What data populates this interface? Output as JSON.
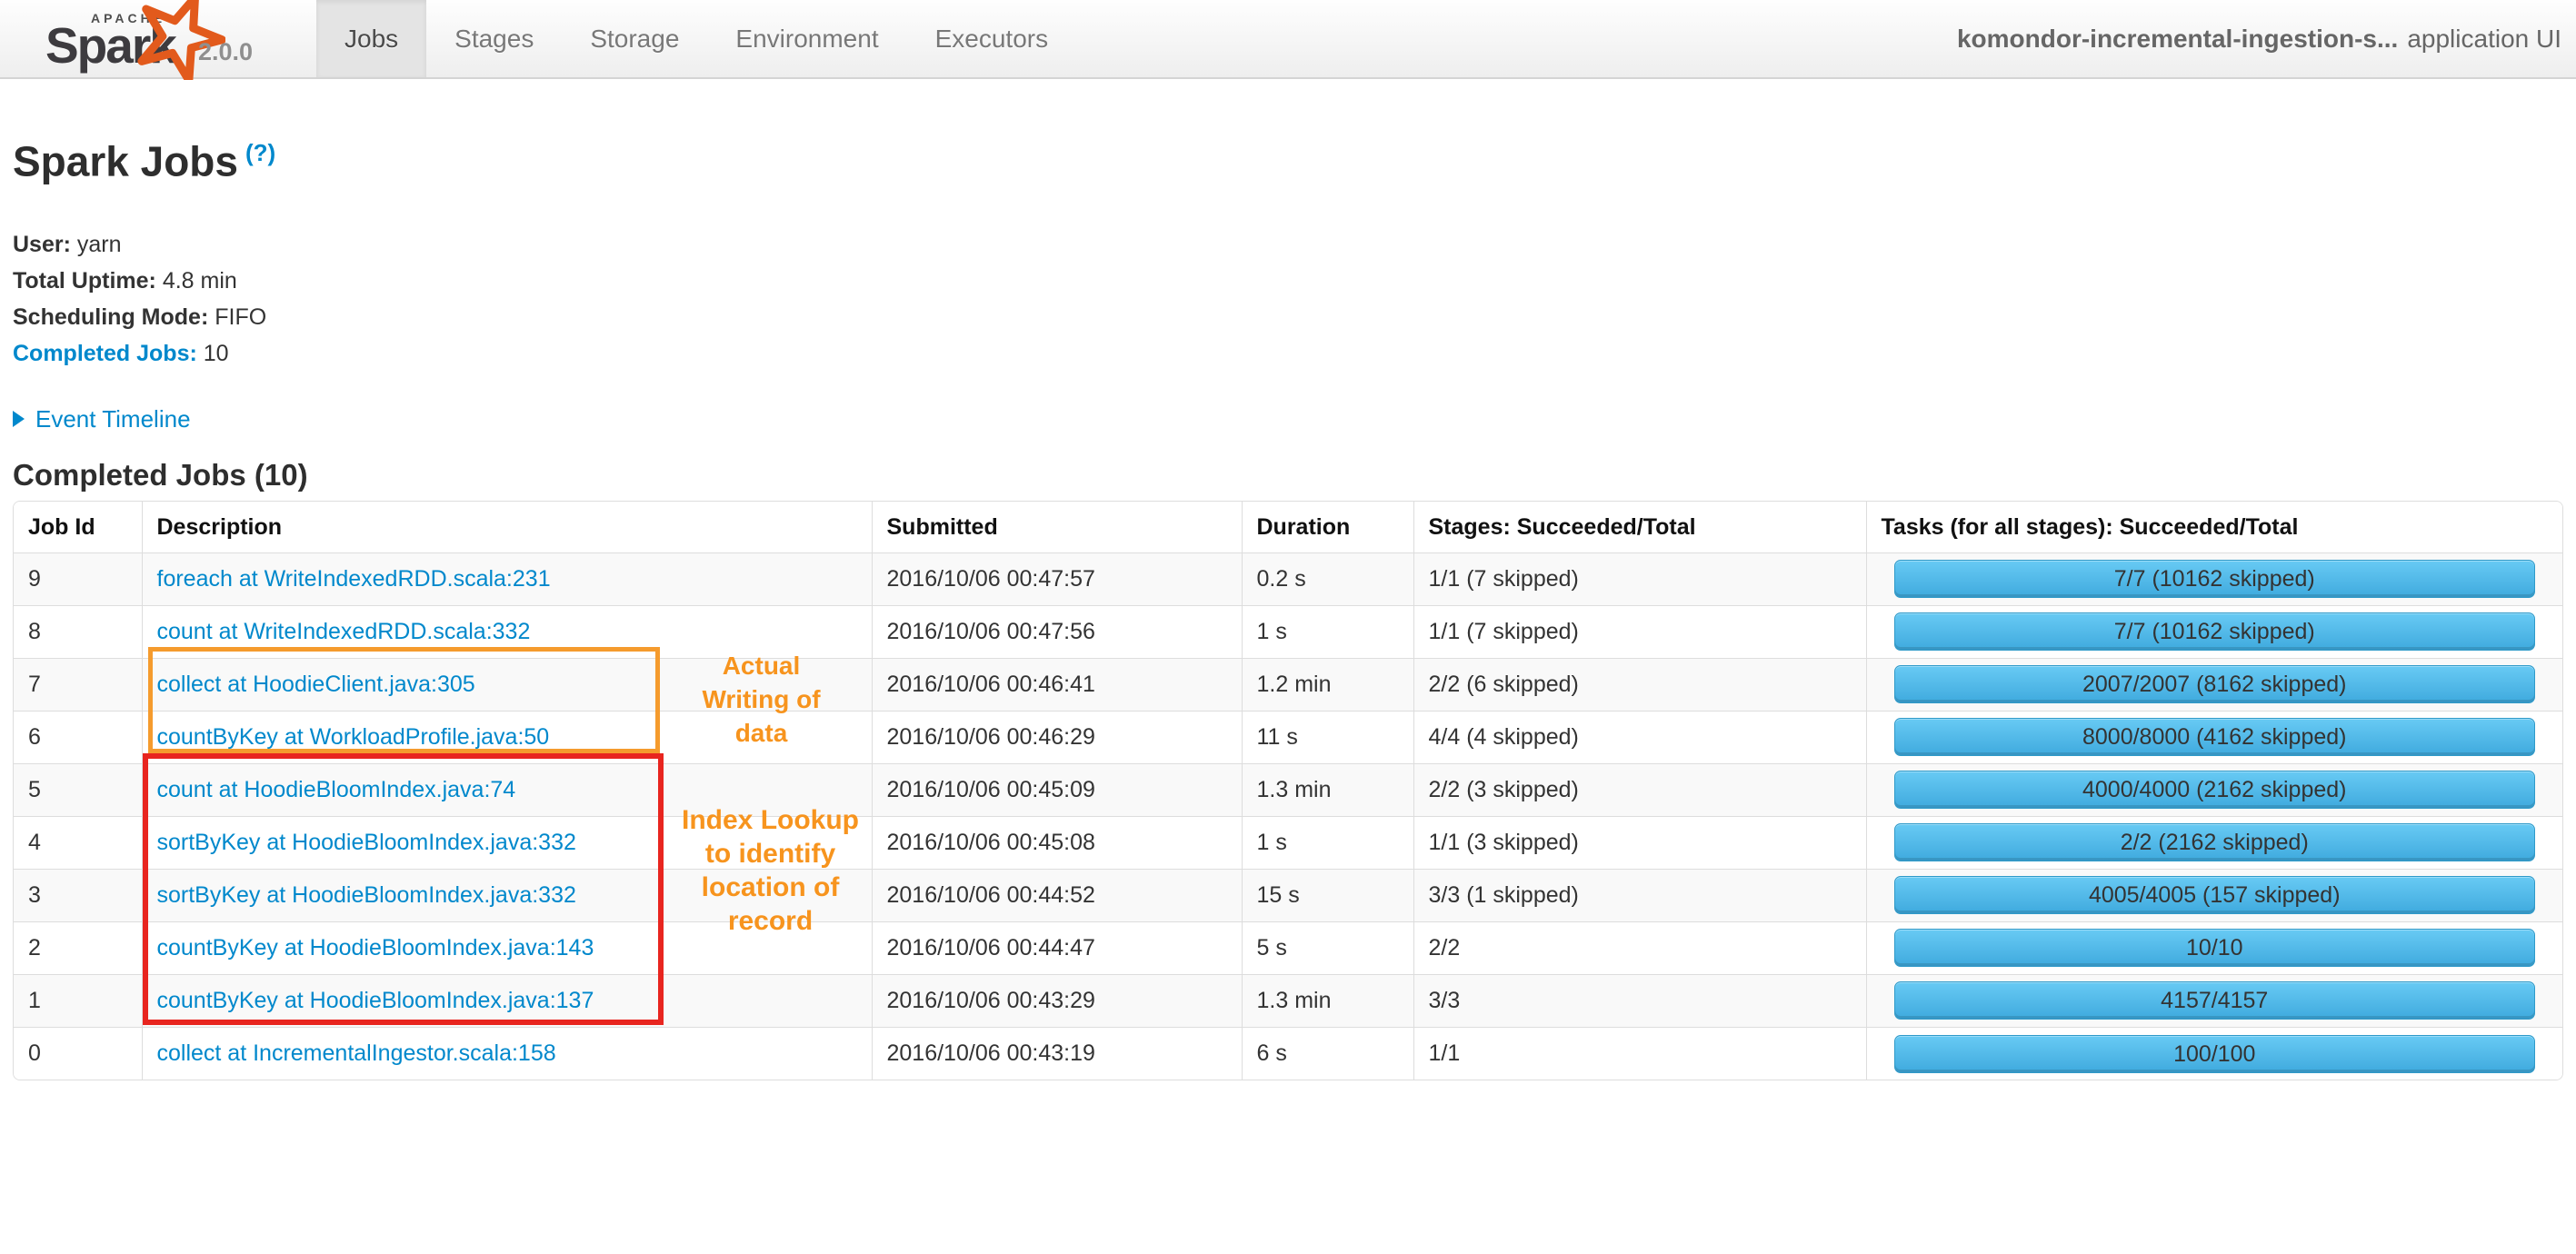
{
  "navbar": {
    "logo": {
      "apache": "APACHE",
      "name": "Spark",
      "version": "2.0.0"
    },
    "tabs": [
      {
        "label": "Jobs",
        "active": true
      },
      {
        "label": "Stages",
        "active": false
      },
      {
        "label": "Storage",
        "active": false
      },
      {
        "label": "Environment",
        "active": false
      },
      {
        "label": "Executors",
        "active": false
      }
    ],
    "app_name": "komondor-incremental-ingestion-s...",
    "app_suffix": "application UI"
  },
  "page": {
    "title": "Spark Jobs",
    "help_badge": "(?)",
    "info": [
      {
        "label": "User:",
        "value": "yarn"
      },
      {
        "label": "Total Uptime:",
        "value": "4.8 min"
      },
      {
        "label": "Scheduling Mode:",
        "value": "FIFO"
      },
      {
        "label": "Completed Jobs:",
        "value": "10"
      }
    ],
    "event_timeline_label": "Event Timeline",
    "section_title": "Completed Jobs (10)"
  },
  "table": {
    "columns": [
      "Job Id",
      "Description",
      "Submitted",
      "Duration",
      "Stages: Succeeded/Total",
      "Tasks (for all stages): Succeeded/Total"
    ],
    "rows": [
      {
        "job_id": "9",
        "description": "foreach at WriteIndexedRDD.scala:231",
        "submitted": "2016/10/06 00:47:57",
        "duration": "0.2 s",
        "stages": "1/1 (7 skipped)",
        "tasks": "7/7 (10162 skipped)",
        "progress_pct": 100
      },
      {
        "job_id": "8",
        "description": "count at WriteIndexedRDD.scala:332",
        "submitted": "2016/10/06 00:47:56",
        "duration": "1 s",
        "stages": "1/1 (7 skipped)",
        "tasks": "7/7 (10162 skipped)",
        "progress_pct": 100
      },
      {
        "job_id": "7",
        "description": "collect at HoodieClient.java:305",
        "submitted": "2016/10/06 00:46:41",
        "duration": "1.2 min",
        "stages": "2/2 (6 skipped)",
        "tasks": "2007/2007 (8162 skipped)",
        "progress_pct": 100
      },
      {
        "job_id": "6",
        "description": "countByKey at WorkloadProfile.java:50",
        "submitted": "2016/10/06 00:46:29",
        "duration": "11 s",
        "stages": "4/4 (4 skipped)",
        "tasks": "8000/8000 (4162 skipped)",
        "progress_pct": 100
      },
      {
        "job_id": "5",
        "description": "count at HoodieBloomIndex.java:74",
        "submitted": "2016/10/06 00:45:09",
        "duration": "1.3 min",
        "stages": "2/2 (3 skipped)",
        "tasks": "4000/4000 (2162 skipped)",
        "progress_pct": 100
      },
      {
        "job_id": "4",
        "description": "sortByKey at HoodieBloomIndex.java:332",
        "submitted": "2016/10/06 00:45:08",
        "duration": "1 s",
        "stages": "1/1 (3 skipped)",
        "tasks": "2/2 (2162 skipped)",
        "progress_pct": 100
      },
      {
        "job_id": "3",
        "description": "sortByKey at HoodieBloomIndex.java:332",
        "submitted": "2016/10/06 00:44:52",
        "duration": "15 s",
        "stages": "3/3 (1 skipped)",
        "tasks": "4005/4005 (157 skipped)",
        "progress_pct": 100
      },
      {
        "job_id": "2",
        "description": "countByKey at HoodieBloomIndex.java:143",
        "submitted": "2016/10/06 00:44:47",
        "duration": "5 s",
        "stages": "2/2",
        "tasks": "10/10",
        "progress_pct": 100
      },
      {
        "job_id": "1",
        "description": "countByKey at HoodieBloomIndex.java:137",
        "submitted": "2016/10/06 00:43:29",
        "duration": "1.3 min",
        "stages": "3/3",
        "tasks": "4157/4157",
        "progress_pct": 100
      },
      {
        "job_id": "0",
        "description": "collect at IncrementalIngestor.scala:158",
        "submitted": "2016/10/06 00:43:19",
        "duration": "6 s",
        "stages": "1/1",
        "tasks": "100/100",
        "progress_pct": 100
      }
    ]
  },
  "annotations": {
    "writing": {
      "text": "Actual\nWriting of\ndata"
    },
    "lookup": {
      "text": "Index Lookup\nto identify\nlocation of\nrecord"
    }
  },
  "colors": {
    "link_blue": "#0088cc",
    "annotation_orange_text": "#f7941e",
    "annotation_orange_box": "#f59b2d",
    "annotation_red_box": "#e8251f",
    "progress_bar_top": "#68caf4",
    "progress_bar_bottom": "#3faade",
    "progress_bar_border": "#2f9ac9",
    "navbar_active_bg": "#e4e4e4",
    "table_border": "#dddddd",
    "row_stripe": "#f9f9f9",
    "spark_logo_orange": "#e25a1c"
  }
}
